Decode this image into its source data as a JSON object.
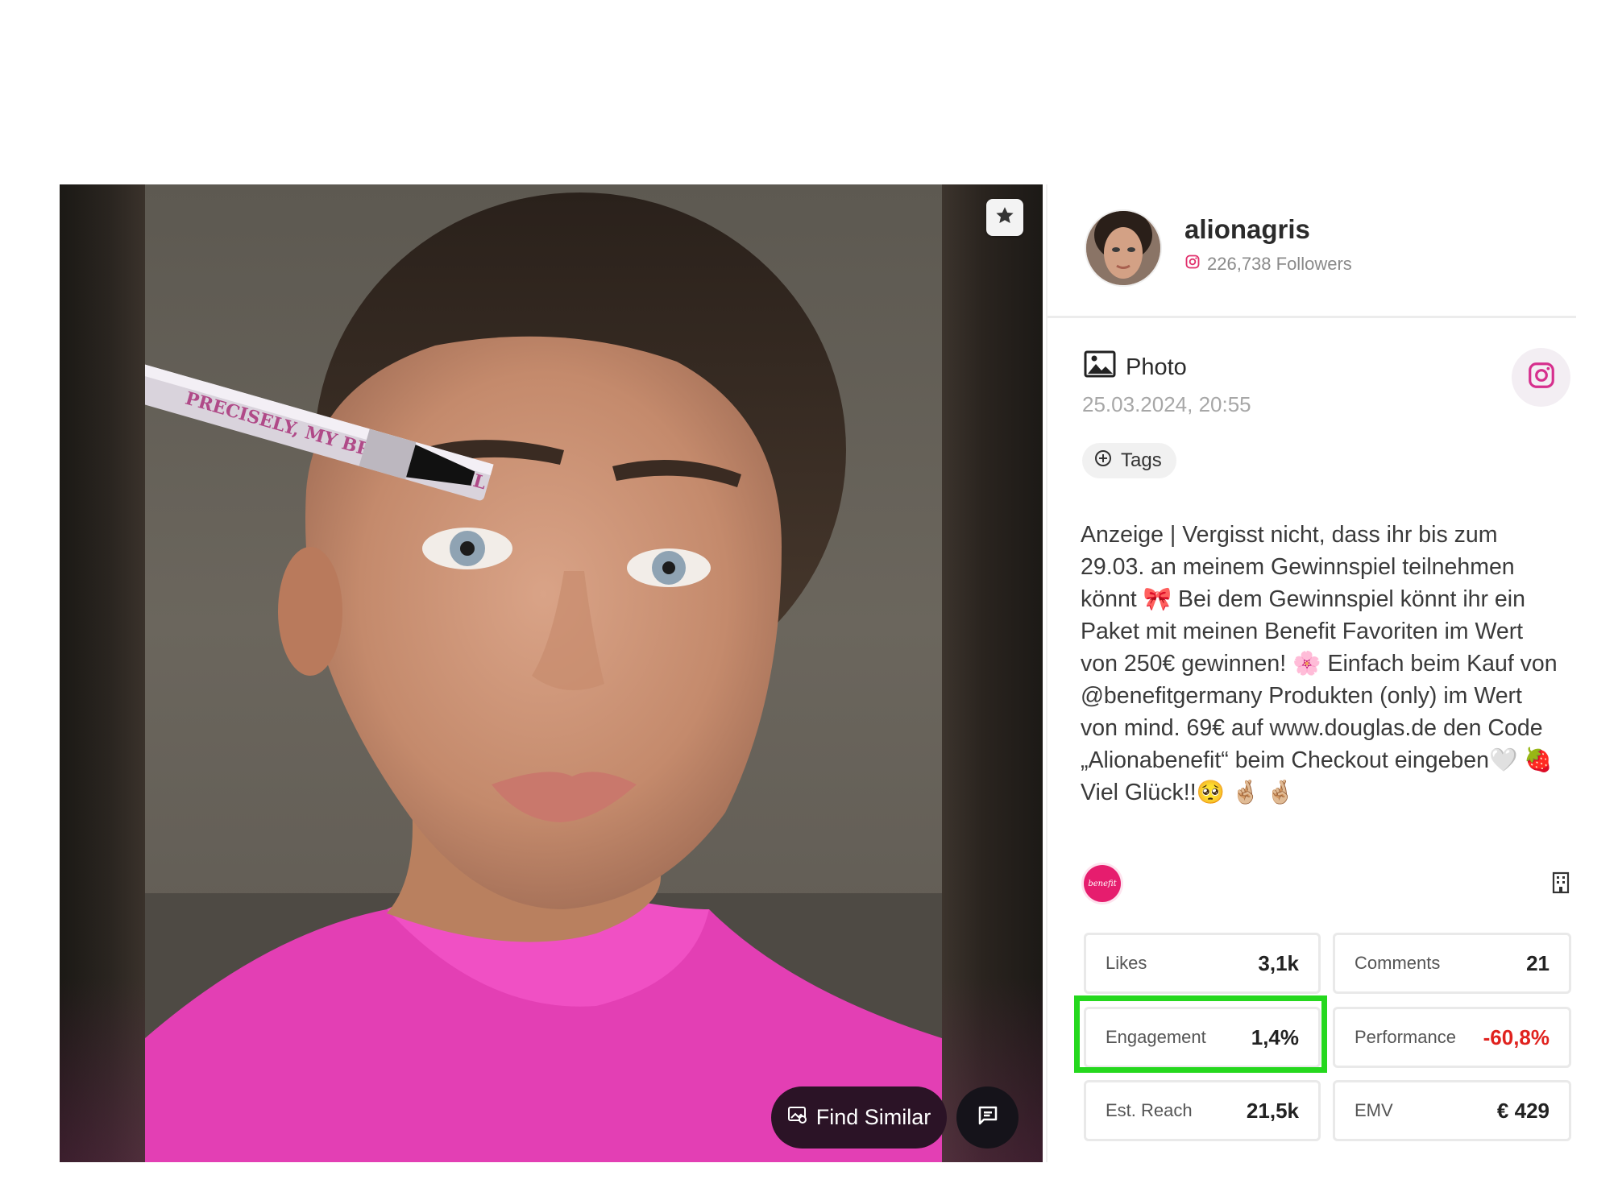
{
  "media": {
    "find_similar_label": "Find Similar",
    "icons": {
      "pin": "star-pin-icon",
      "find_similar": "image-search-icon",
      "comment": "comment-icon"
    }
  },
  "profile": {
    "username": "alionagris",
    "followers": "226,738 Followers",
    "platform_icon": "instagram-icon",
    "accent_color": "#e1306c"
  },
  "post": {
    "type_label": "Photo",
    "type_icon": "photo-icon",
    "date": "25.03.2024, 20:55",
    "tags_label": "Tags",
    "caption": "Anzeige | Vergisst nicht, dass ihr bis zum 29.03. an meinem Gewinnspiel teilnehmen könnt 🎀 Bei dem Gewinnspiel könnt ihr ein Paket mit meinen Benefit Favoriten im Wert von 250€ gewinnen! 🌸 Einfach beim Kauf von @benefitgermany Produkten (only) im Wert von mind. 69€ auf www.douglas.de den Code „Alionabenefit“ beim Checkout eingeben🤍 🍓 Viel Glück!!🥺 🤞🏼 🤞🏼",
    "brand_logo_text": "benefit"
  },
  "metrics": [
    {
      "label": "Likes",
      "value": "3,1k"
    },
    {
      "label": "Comments",
      "value": "21"
    },
    {
      "label": "Engagement",
      "value": "1,4%"
    },
    {
      "label": "Performance",
      "value": "-60,8%",
      "negative": true
    },
    {
      "label": "Est. Reach",
      "value": "21,5k"
    },
    {
      "label": "EMV",
      "value": "€ 429"
    }
  ],
  "colors": {
    "highlight": "#25d81e",
    "negative": "#e0221e"
  }
}
